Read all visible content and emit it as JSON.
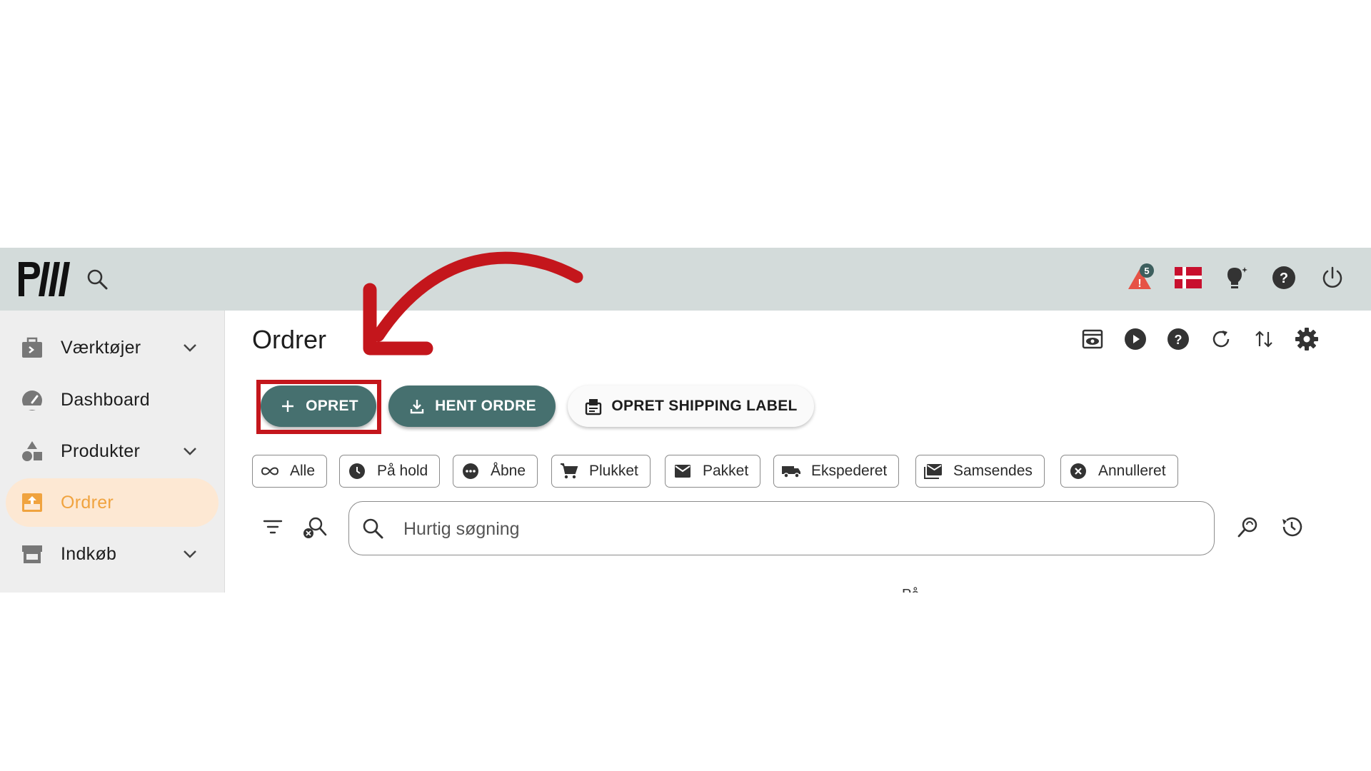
{
  "app": {
    "logo_text": "PW"
  },
  "topbar": {
    "notification_count": "5",
    "language": "Danish"
  },
  "sidebar": {
    "items": [
      {
        "label": "Værktøjer",
        "icon": "toolbox-icon",
        "expandable": true
      },
      {
        "label": "Dashboard",
        "icon": "gauge-icon",
        "expandable": false
      },
      {
        "label": "Produkter",
        "icon": "shapes-icon",
        "expandable": true
      },
      {
        "label": "Ordrer",
        "icon": "order-icon",
        "expandable": false,
        "active": true
      },
      {
        "label": "Indkøb",
        "icon": "store-icon",
        "expandable": true
      }
    ]
  },
  "main": {
    "title": "Ordrer",
    "buttons": {
      "create": "OPRET",
      "fetch": "HENT ORDRE",
      "shipping": "OPRET SHIPPING LABEL"
    },
    "filters": [
      "Alle",
      "På hold",
      "Åbne",
      "Plukket",
      "Pakket",
      "Ekspederet",
      "Samsendes",
      "Annulleret"
    ],
    "search": {
      "placeholder": "Hurtig søgning",
      "value": ""
    },
    "clipped_text": "På"
  },
  "colors": {
    "accent": "#46706f",
    "active": "#f0a33f",
    "active_bg": "#fde8d3",
    "topbar": "#d3dbda",
    "annotation": "#c4161c"
  }
}
